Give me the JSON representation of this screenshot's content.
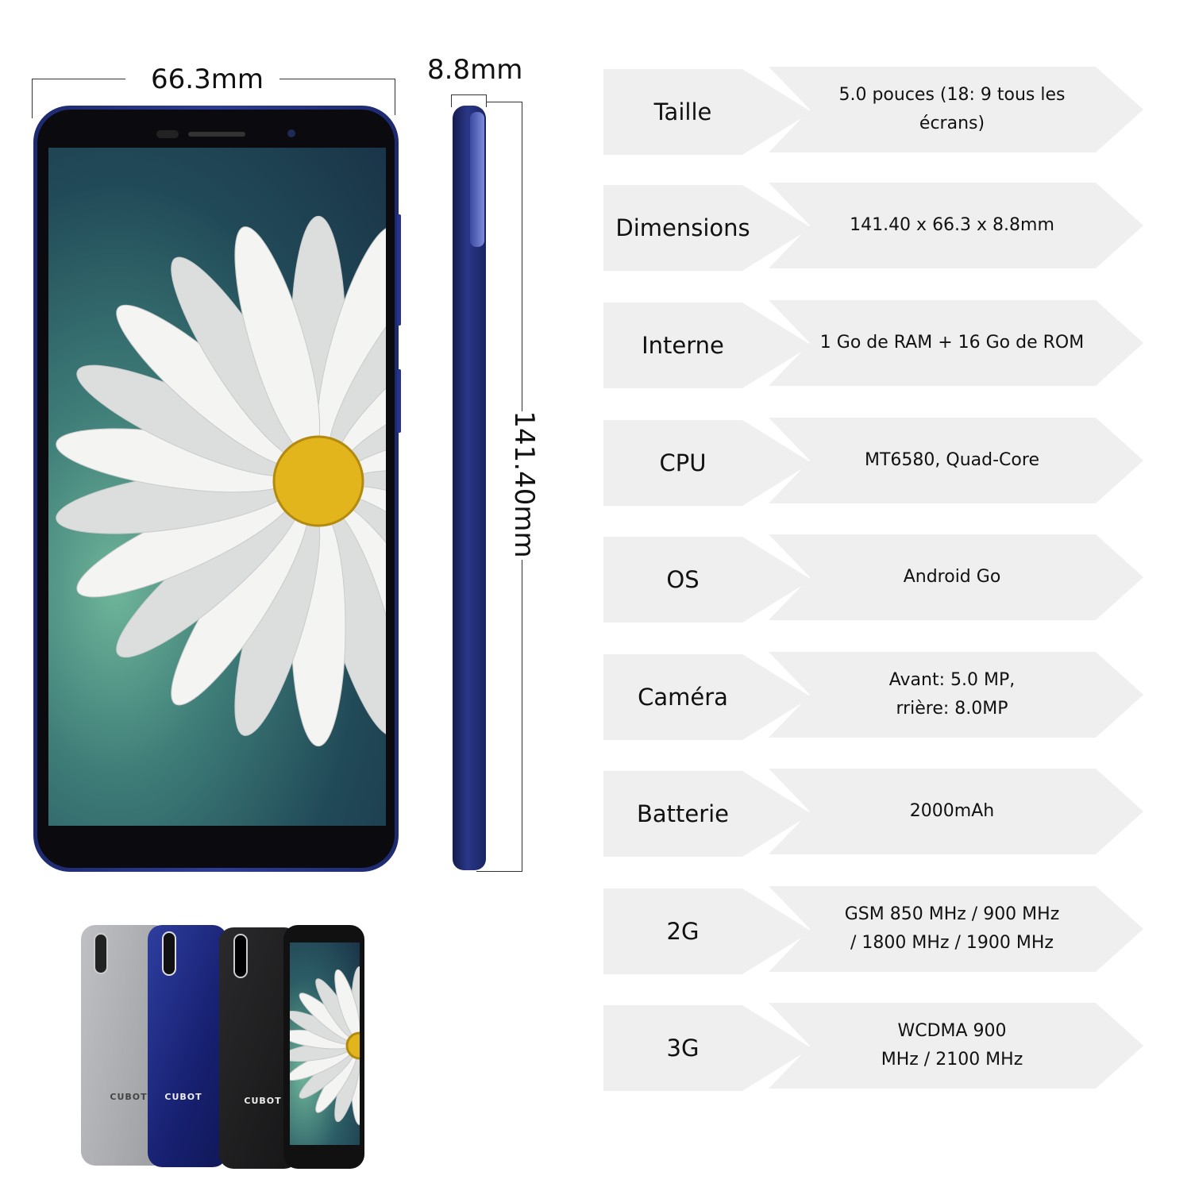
{
  "dimensions": {
    "width": "66.3mm",
    "thickness": "8.8mm",
    "height": "141.40mm"
  },
  "brand_logo": "CUBOT",
  "phone_colors": [
    "#a3a5a8",
    "#1e2a7a",
    "#1c1c1e",
    "#111111"
  ],
  "specs": [
    {
      "label": "Taille",
      "value": [
        "5.0 pouces (18: 9 tous les écrans)"
      ]
    },
    {
      "label": "Dimensions",
      "value": [
        "141.40 x 66.3 x 8.8mm"
      ]
    },
    {
      "label": "Interne",
      "value": [
        "1 Go de RAM + 16 Go de ROM"
      ]
    },
    {
      "label": "CPU",
      "value": [
        "MT6580, Quad-Core"
      ]
    },
    {
      "label": "OS",
      "value": [
        "Android Go"
      ]
    },
    {
      "label": "Caméra",
      "value": [
        "Avant: 5.0 MP,",
        "rrière: 8.0MP"
      ]
    },
    {
      "label": "Batterie",
      "value": [
        "2000mAh"
      ]
    },
    {
      "label": "2G",
      "value": [
        "GSM 850 MHz / 900 MHz",
        "/ 1800 MHz / 1900 MHz"
      ]
    },
    {
      "label": "3G",
      "value": [
        "WCDMA 900",
        "MHz / 2100 MHz"
      ]
    }
  ]
}
